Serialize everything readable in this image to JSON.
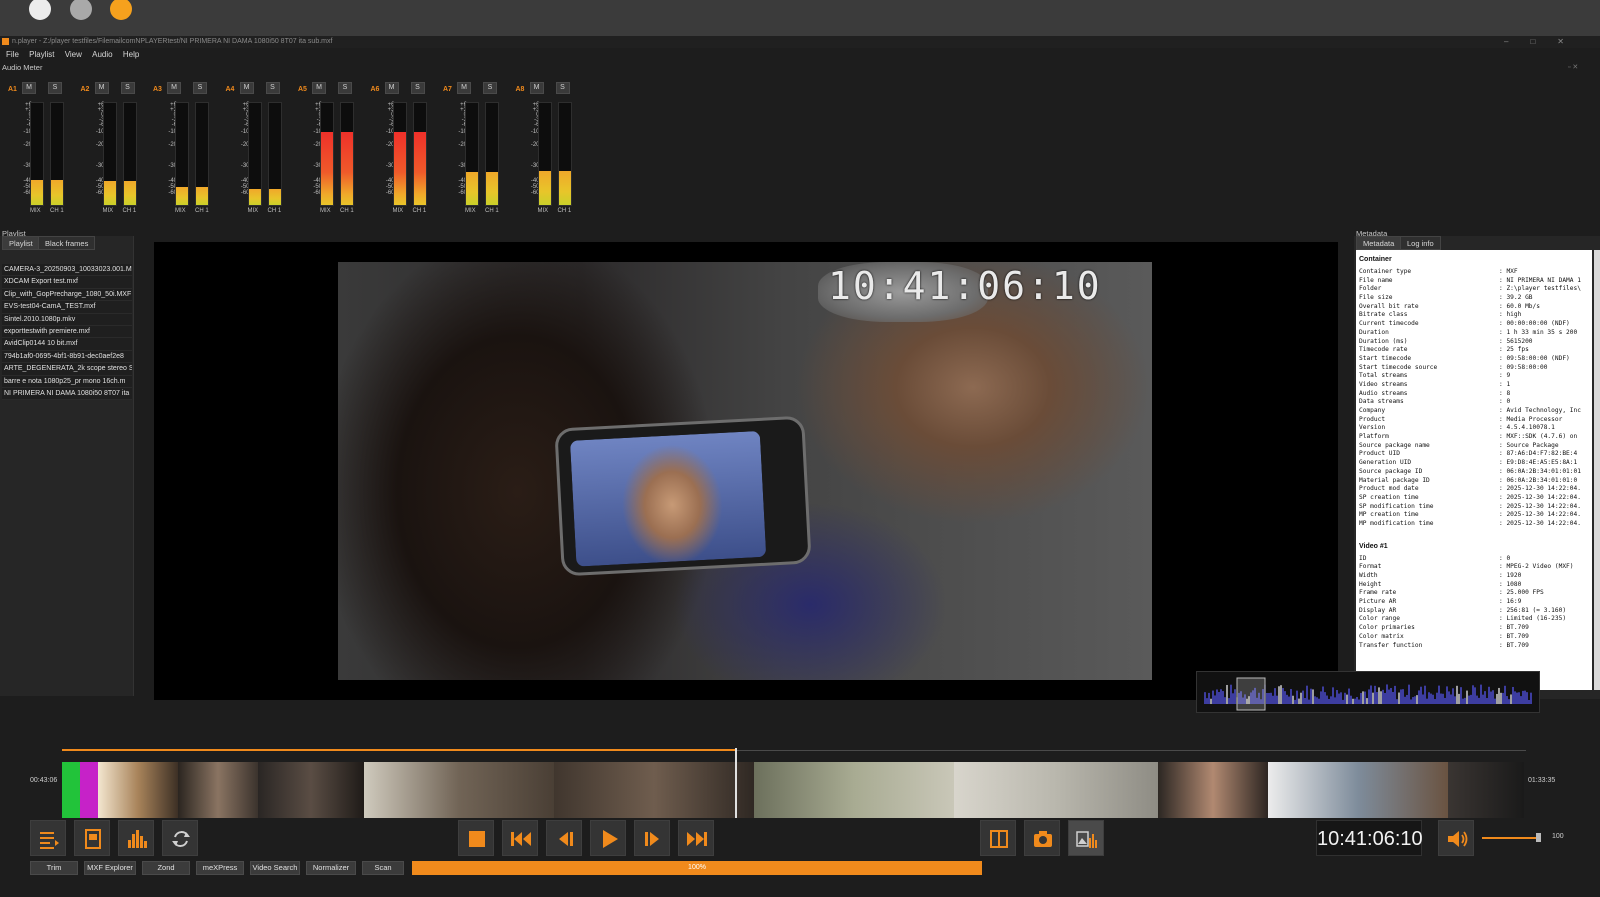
{
  "window": {
    "title": "n.player - Z:/player testfiles/FilemailcomNPLAYERtest/NI PRIMERA NI DAMA 1080i50 8T07 ita sub.mxf",
    "controls": [
      "–",
      "□",
      "✕"
    ]
  },
  "menu": [
    "File",
    "Playlist",
    "View",
    "Audio",
    "Help"
  ],
  "audio_meter": {
    "title": "Audio Meter",
    "scale": [
      "+6",
      "+3",
      "0",
      "-3",
      "-6",
      "-10",
      "-20",
      "-30",
      "-40",
      "-50",
      "-60"
    ],
    "mute_label": "M",
    "solo_label": "S",
    "mix_label": "MIX",
    "ch_label": "CH 1",
    "groups": [
      {
        "name": "A1",
        "mix_level": 0.25,
        "ch_level": 0.25
      },
      {
        "name": "A2",
        "mix_level": 0.24,
        "ch_level": 0.24
      },
      {
        "name": "A3",
        "mix_level": 0.18,
        "ch_level": 0.18
      },
      {
        "name": "A4",
        "mix_level": 0.16,
        "ch_level": 0.16
      },
      {
        "name": "A5",
        "mix_level": 0.72,
        "ch_level": 0.72
      },
      {
        "name": "A6",
        "mix_level": 0.72,
        "ch_level": 0.72
      },
      {
        "name": "A7",
        "mix_level": 0.32,
        "ch_level": 0.32
      },
      {
        "name": "A8",
        "mix_level": 0.33,
        "ch_level": 0.33
      }
    ]
  },
  "playlist": {
    "title": "Playlist",
    "tabs": [
      "Playlist",
      "Black frames"
    ],
    "items": [
      "CAMERA-3_20250903_10033023.001.M",
      "XDCAM Export test.mxf",
      "Clip_with_GopPrecharge_1080_50i.MXF",
      "EVS-test04-CamA_TEST.mxf",
      "Sintel.2010.1080p.mkv",
      "exporttestwith premiere.mxf",
      "AvidClip0144 10 bit.mxf",
      "794b1af0-0695-4bf1-8b91-dec0aef2e8",
      "ARTE_DEGENERATA_2k scope stereo SV",
      "barre e nota 1080p25_pr mono 16ch.m",
      "NI PRIMERA NI DAMA 1080i50 8T07 ita"
    ]
  },
  "video": {
    "timecode_overlay": "10:41:06:10"
  },
  "metadata": {
    "title": "Metadata",
    "tabs": [
      "Metadata",
      "Log info"
    ],
    "container_heading": "Container",
    "container": [
      [
        "Container type",
        ": MXF"
      ],
      [
        "File name",
        ": NI PRIMERA NI DAMA 1"
      ],
      [
        "Folder",
        ": Z:\\player testfiles\\"
      ],
      [
        "File size",
        ": 39.2 GB"
      ],
      [
        "Overall bit rate",
        ": 60.0 Mb/s"
      ],
      [
        "Bitrate class",
        ": high"
      ],
      [
        "Current timecode",
        ": 00:00:00:00 (NDF)"
      ],
      [
        "Duration",
        ": 1 h 33 min 35 s 200"
      ],
      [
        "Duration (ms)",
        ": 5615200"
      ],
      [
        "Timecode rate",
        ": 25 fps"
      ],
      [
        "Start timecode",
        ": 09:58:00:00 (NDF)"
      ],
      [
        "Start timecode source",
        ": 09:58:00:00"
      ],
      [
        "Total streams",
        ": 9"
      ],
      [
        "Video streams",
        ": 1"
      ],
      [
        "Audio streams",
        ": 8"
      ],
      [
        "Data streams",
        ": 0"
      ],
      [
        "Company",
        ": Avid Technology, Inc"
      ],
      [
        "Product",
        ": Media Processor"
      ],
      [
        "Version",
        ": 4.5.4.10078.1"
      ],
      [
        "Platform",
        ": MXF::SDK (4.7.6) on"
      ],
      [
        "Source package name",
        ": Source Package"
      ],
      [
        "Product UID",
        ": 87:A6:D4:F7:82:BE:4"
      ],
      [
        "Generation UID",
        ": E9:D8:4E:A5:E5:8A:1"
      ],
      [
        "Source package ID",
        ": 06:0A:2B:34:01:01:01"
      ],
      [
        "Material package ID",
        ": 06:0A:2B:34:01:01:0"
      ],
      [
        "Product mod date",
        ": 2025-12-30 14:22:04."
      ],
      [
        "SP creation time",
        ": 2025-12-30 14:22:04."
      ],
      [
        "SP modification time",
        ": 2025-12-30 14:22:04."
      ],
      [
        "MP creation time",
        ": 2025-12-30 14:22:04."
      ],
      [
        "MP modification time",
        ": 2025-12-30 14:22:04."
      ]
    ],
    "video_heading": "Video #1",
    "video": [
      [
        "ID",
        ": 0"
      ],
      [
        "Format",
        ": MPEG-2 Video (MXF)"
      ],
      [
        "Width",
        ": 1920"
      ],
      [
        "Height",
        ": 1080"
      ],
      [
        "Frame rate",
        ": 25.000 FPS"
      ],
      [
        "Picture AR",
        ": 16:9"
      ],
      [
        "Display AR",
        ": 256:81 (≈ 3.160)"
      ],
      [
        "Color range",
        ": Limited (16-235)"
      ],
      [
        "Color primaries",
        ": BT.709"
      ],
      [
        "Color matrix",
        ": BT.709"
      ],
      [
        "Transfer function",
        ": BT.709"
      ]
    ]
  },
  "timeline": {
    "start_tc": "00:43:06",
    "end_tc": "01:33:35",
    "position": 0.46
  },
  "controls": {
    "timecode": "10:41:06:10",
    "volume": "100",
    "volume_level": 1.0,
    "progress_label": "100%",
    "progress": 1.0,
    "buttons": [
      "Trim",
      "MXF Explorer",
      "Zond",
      "meXPress",
      "Video Search",
      "Normalizer",
      "Scan"
    ]
  },
  "colors": {
    "accent": "#f08a1c",
    "meter_green": "#8fd02a",
    "meter_red": "#f0302a"
  }
}
